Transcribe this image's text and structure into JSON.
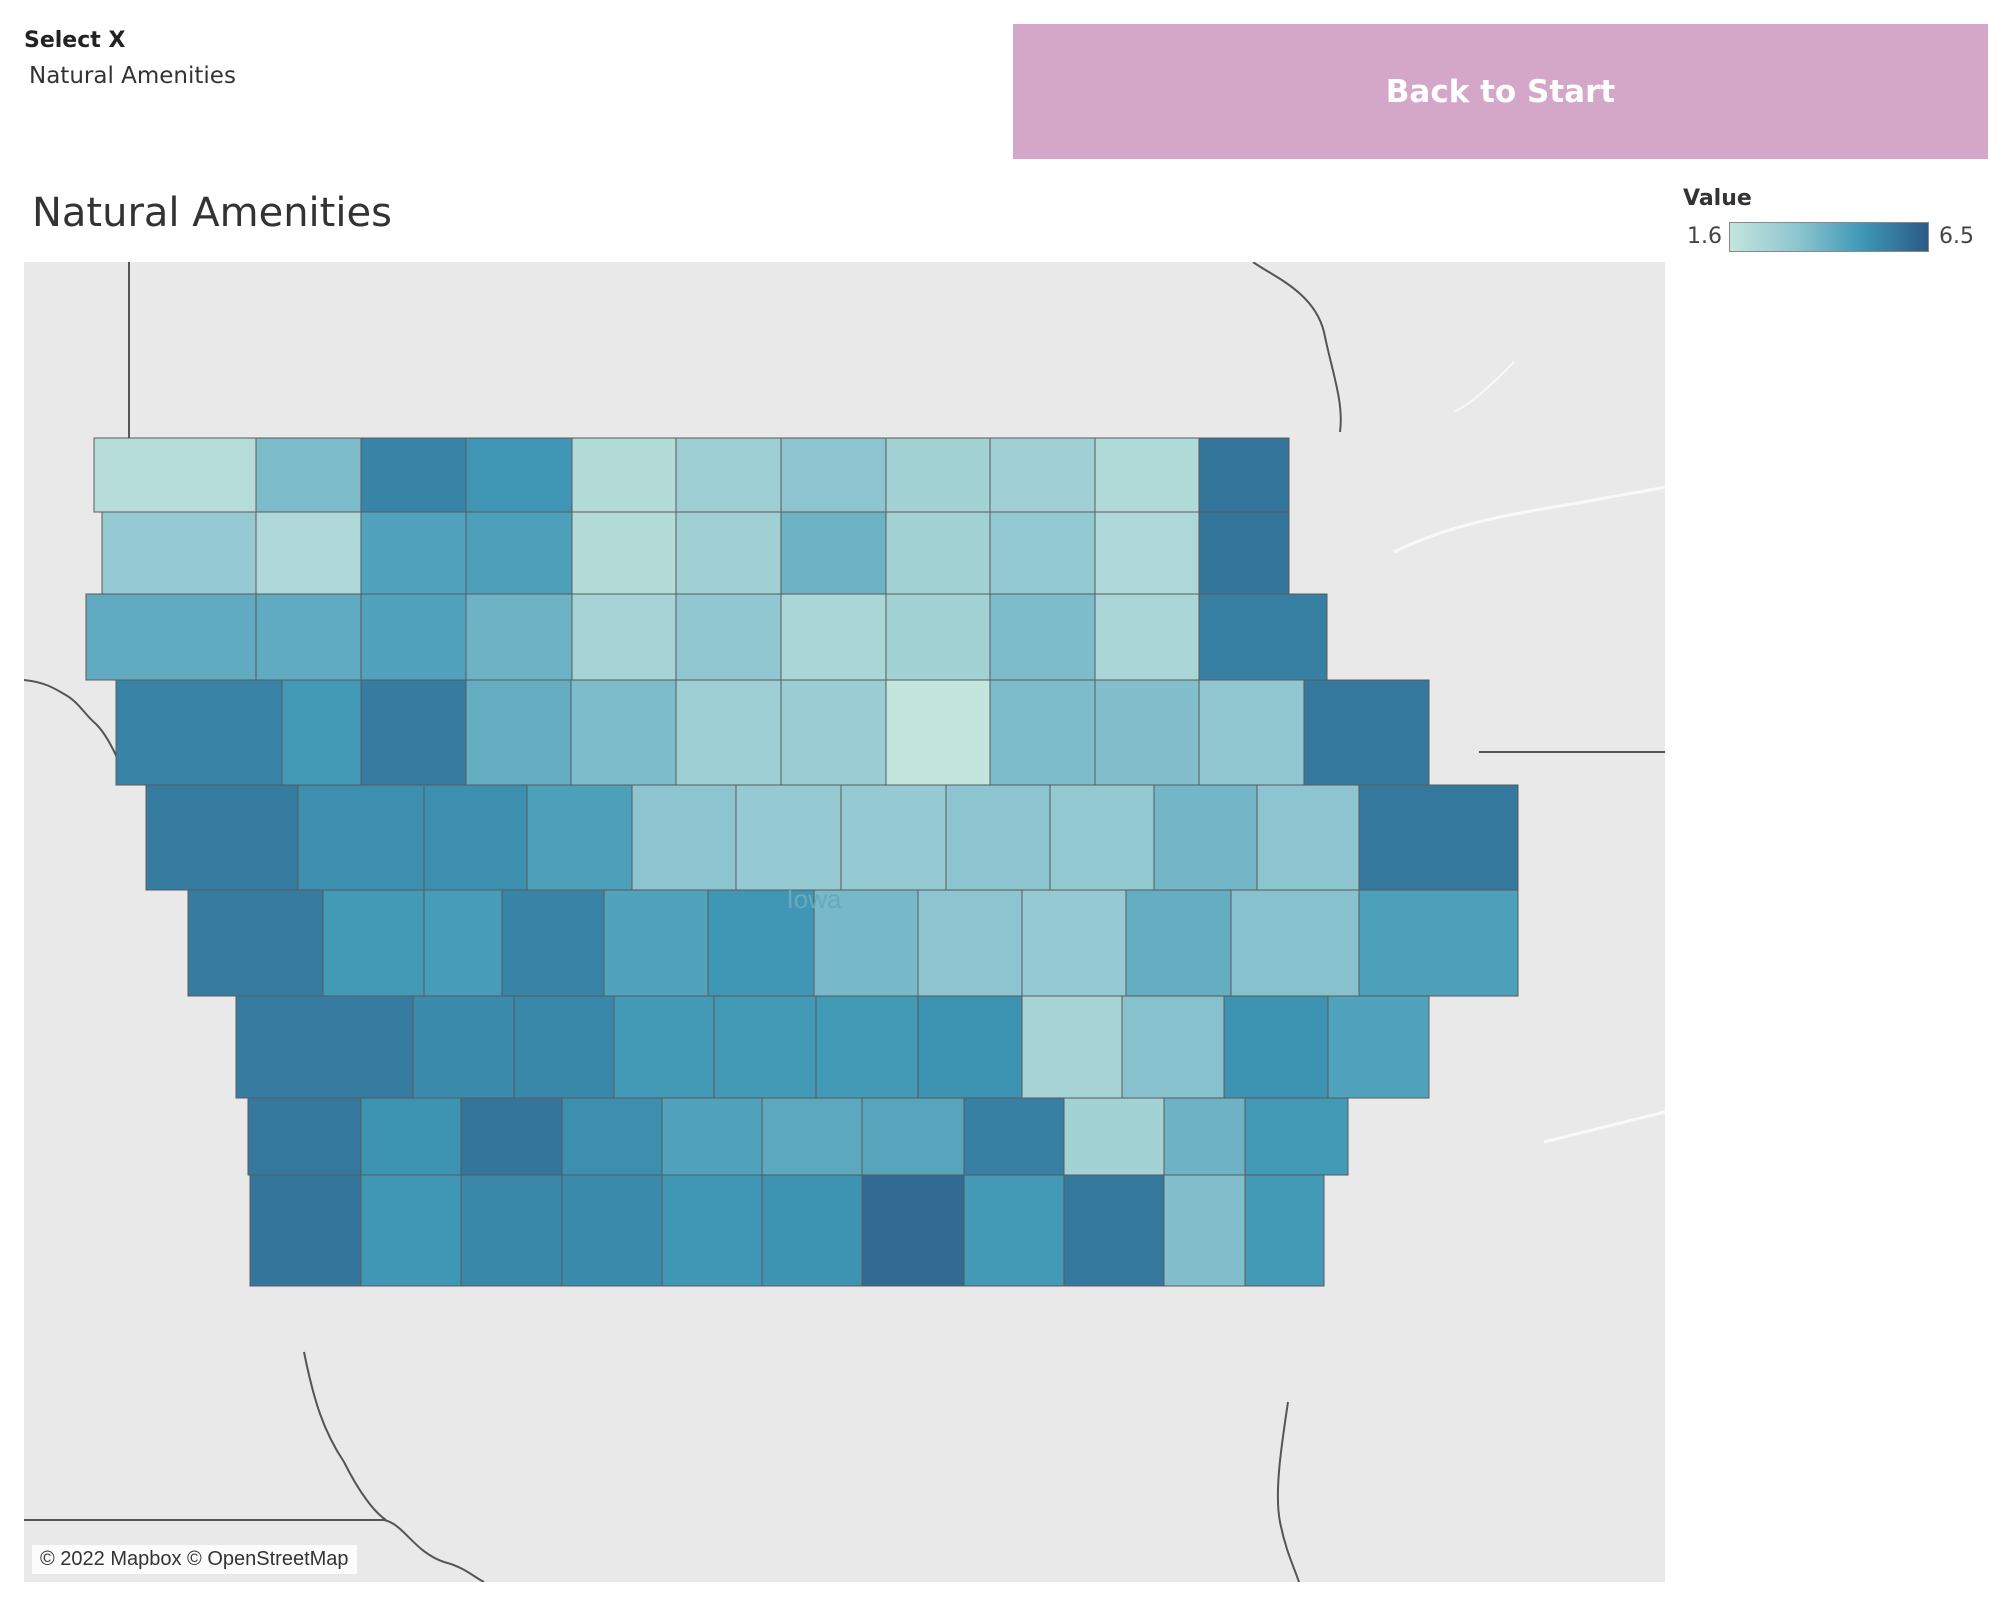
{
  "filter": {
    "label": "Select X",
    "value": "Natural Amenities"
  },
  "back_button": {
    "label": "Back to Start",
    "color": "#d4a6c8"
  },
  "map": {
    "title": "Natural Amenities",
    "state_label": "Iowa",
    "attribution": "© 2022 Mapbox © OpenStreetMap",
    "basemap_color": "#e9e9e9"
  },
  "legend": {
    "title": "Value",
    "min": "1.6",
    "max": "6.5",
    "min_value": 1.6,
    "max_value": 6.5,
    "colors": [
      "#c3e5dd",
      "#8fc6d0",
      "#3f98b6",
      "#2b5a86"
    ]
  },
  "chart_data": {
    "type": "choropleth",
    "title": "Natural Amenities",
    "measure": "Value",
    "range": [
      1.6,
      6.5
    ],
    "rows": [
      [
        2.0,
        3.6,
        5.4,
        4.9,
        2.1,
        2.8,
        3.3,
        2.6,
        2.7,
        2.2,
        5.8
      ],
      [
        3.0,
        2.3,
        4.5,
        4.6,
        2.1,
        2.7,
        3.9,
        2.6,
        3.1,
        2.3,
        5.8
      ],
      [
        4.2,
        4.2,
        4.5,
        3.9,
        2.5,
        3.2,
        2.4,
        2.6,
        3.6,
        2.4,
        5.5
      ],
      [
        5.4,
        4.8,
        5.6,
        4.1,
        3.6,
        2.8,
        2.9,
        1.6,
        3.6,
        3.5,
        3.2,
        5.7
      ],
      [
        5.6,
        5.1,
        5.1,
        4.6,
        3.3,
        3.0,
        3.0,
        3.3,
        3.1,
        3.8,
        3.3,
        5.7
      ],
      [
        5.6,
        4.8,
        4.7,
        5.4,
        4.5,
        4.9,
        3.7,
        3.3,
        3.0,
        4.1,
        3.4,
        4.6
      ],
      [
        5.6,
        5.2,
        5.3,
        4.8,
        4.8,
        4.8,
        5.0,
        2.5,
        3.4,
        5.0,
        4.5
      ],
      [
        5.7,
        5.0,
        5.8,
        5.1,
        4.5,
        4.3,
        4.4,
        5.5,
        2.6,
        3.9,
        4.8
      ],
      [
        5.8,
        4.9,
        5.3,
        5.2,
        4.9,
        5.0,
        6.1,
        4.8,
        5.7,
        3.5,
        4.8
      ]
    ]
  }
}
